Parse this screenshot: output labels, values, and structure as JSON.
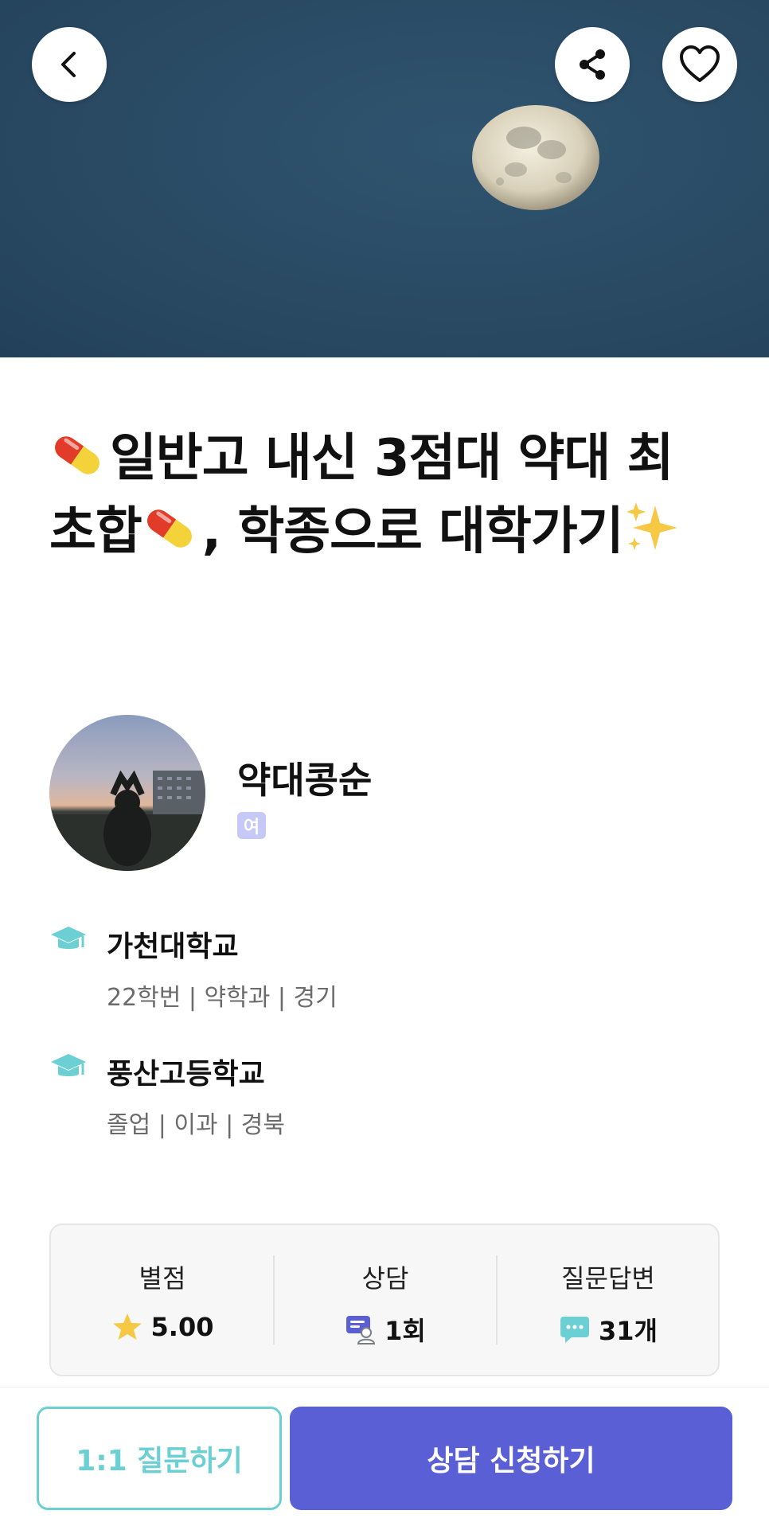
{
  "header": {
    "back_icon": "chevron-left-icon",
    "share_icon": "share-icon",
    "like_icon": "heart-icon"
  },
  "title": {
    "line1_text": "일반고 내신 3점대 약대 최",
    "line2_text_a": "초합",
    "line2_text_b": ", 학종으로 대학가기"
  },
  "mentor": {
    "name": "약대콩순",
    "gender": "여"
  },
  "education": [
    {
      "name": "가천대학교",
      "detail": "22학번 | 약학과 | 경기"
    },
    {
      "name": "풍산고등학교",
      "detail": "졸업 | 이과 | 경북"
    }
  ],
  "stats": [
    {
      "label": "별점",
      "value": "5.00",
      "icon": "star-icon"
    },
    {
      "label": "상담",
      "value": "1회",
      "icon": "consult-icon"
    },
    {
      "label": "질문답변",
      "value": "31개",
      "icon": "chat-bubble-icon"
    }
  ],
  "actions": {
    "question_label": "1:1 질문하기",
    "consult_label": "상담 신청하기"
  },
  "colors": {
    "primary": "#5b5fd6",
    "accent": "#6ccfd4",
    "hero_bg": "#2a4a63"
  }
}
